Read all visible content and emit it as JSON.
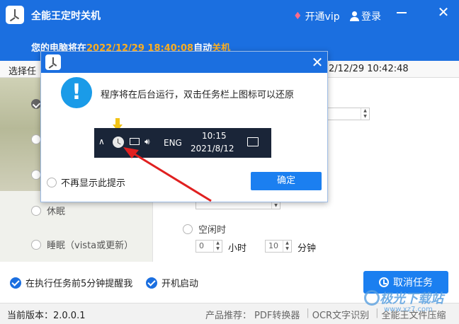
{
  "app": {
    "title": "全能王定时关机",
    "vip_label": "开通vip",
    "login_label": "登录",
    "colors": {
      "accent": "#1b6fe0",
      "highlight": "#ffb020"
    }
  },
  "shutdown_notice": {
    "prefix": "您的电脑将在",
    "datetime": "2022/12/29 18:40:08",
    "middle": "自动",
    "action": "关机"
  },
  "main": {
    "section_label": "选择任",
    "current_time": "2/12/29 10:42:48",
    "options": [
      {
        "label": "休眠",
        "checked": false
      },
      {
        "label": "睡眠（vista或更新）",
        "checked": false
      }
    ],
    "idle_label": "空闲时",
    "idle_hours": "0",
    "hour_unit": "小时",
    "idle_minutes": "10",
    "minute_unit": "分钟",
    "remind_checkbox": "在执行任务前5分钟提醒我",
    "startup_checkbox": "开机启动",
    "cancel_button": "取消任务"
  },
  "statusbar": {
    "version": "当前版本：2.0.0.1",
    "products_label": "产品推荐：",
    "products": [
      "PDF转换器",
      "OCR文字识别",
      "全能王文件压缩"
    ]
  },
  "dialog": {
    "message": "程序将在后台运行，双击任务栏上图标可以还原",
    "taskbar_lang": "ENG",
    "taskbar_time": "10:15",
    "taskbar_date": "2021/8/12",
    "no_show_label": "不再显示此提示",
    "ok_label": "确定"
  },
  "watermark": {
    "text": "极光下载站",
    "url": "www.xz7.com"
  }
}
